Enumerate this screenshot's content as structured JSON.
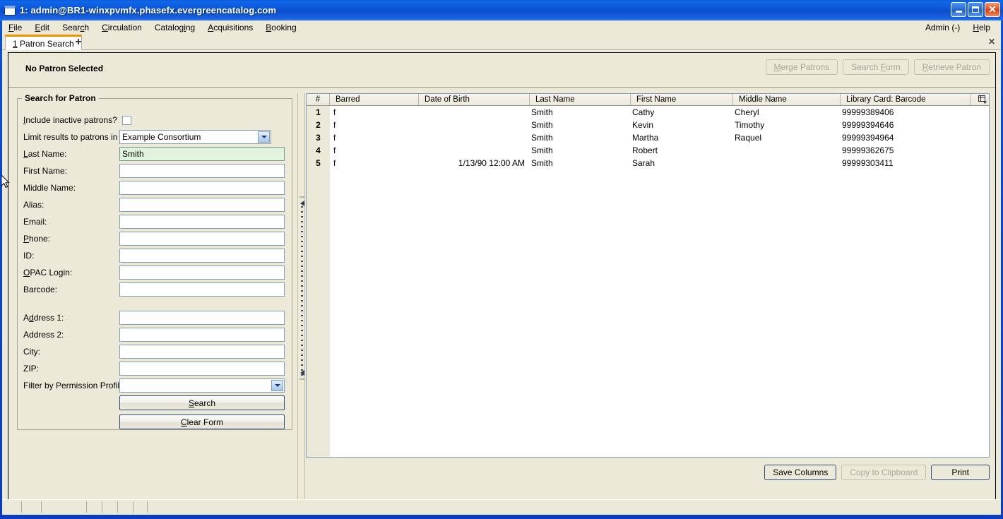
{
  "window": {
    "title": "1: admin@BR1-winxpvmfx.phasefx.evergreencatalog.com",
    "icon": "window-icon",
    "minimize_label": "_",
    "maximize_label": "□",
    "close_label": "✕"
  },
  "menubar": {
    "items": [
      {
        "label": "File"
      },
      {
        "label": "Edit"
      },
      {
        "label": "Search"
      },
      {
        "label": "Circulation"
      },
      {
        "label": "Cataloging"
      },
      {
        "label": "Acquisitions"
      },
      {
        "label": "Booking"
      }
    ],
    "right_items": [
      {
        "label": "Admin (-)"
      },
      {
        "label": "Help"
      }
    ]
  },
  "tabs": {
    "active": {
      "label": "1 Patron Search"
    },
    "new_tab_label": "+",
    "close_label": "✕"
  },
  "patron_header": {
    "status": "No Patron Selected",
    "buttons": [
      {
        "label": "Merge Patrons",
        "enabled": false
      },
      {
        "label": "Search Form",
        "enabled": false
      },
      {
        "label": "Retrieve Patron",
        "enabled": false
      }
    ]
  },
  "search_form": {
    "legend": "Search for Patron",
    "fields": [
      {
        "label": "Include inactive patrons?",
        "type": "checkbox",
        "value": "",
        "checked": false
      },
      {
        "label": "Limit results to patrons in",
        "type": "select",
        "value": "Example Consortium"
      },
      {
        "label": "Last Name:",
        "type": "text",
        "value": "Smith",
        "focused": true
      },
      {
        "label": "First Name:",
        "type": "text",
        "value": ""
      },
      {
        "label": "Middle Name:",
        "type": "text",
        "value": ""
      },
      {
        "label": "Alias:",
        "type": "text",
        "value": ""
      },
      {
        "label": "Email:",
        "type": "text",
        "value": ""
      },
      {
        "label": "Phone:",
        "type": "text",
        "value": ""
      },
      {
        "label": "ID:",
        "type": "text",
        "value": ""
      },
      {
        "label": "OPAC Login:",
        "type": "text",
        "value": ""
      },
      {
        "label": "Barcode:",
        "type": "text",
        "value": ""
      },
      {
        "label": "Address 1:",
        "type": "text",
        "value": ""
      },
      {
        "label": "Address 2:",
        "type": "text",
        "value": ""
      },
      {
        "label": "City:",
        "type": "text",
        "value": ""
      },
      {
        "label": "ZIP:",
        "type": "text",
        "value": ""
      },
      {
        "label": "Filter by Permission Profile:",
        "type": "select",
        "value": ""
      }
    ],
    "search_button": "Search",
    "clear_button": "Clear Form"
  },
  "results": {
    "columns": [
      {
        "label": "#"
      },
      {
        "label": "Barred"
      },
      {
        "label": "Date of Birth"
      },
      {
        "label": "Last Name"
      },
      {
        "label": "First Name"
      },
      {
        "label": "Middle Name"
      },
      {
        "label": "Library Card: Barcode"
      }
    ],
    "rows": [
      {
        "num": "1",
        "barred": "f",
        "dob": "",
        "last": "Smith",
        "first": "Cathy",
        "middle": "Cheryl",
        "barcode": "99999389406"
      },
      {
        "num": "2",
        "barred": "f",
        "dob": "",
        "last": "Smith",
        "first": "Kevin",
        "middle": "Timothy",
        "barcode": "99999394646"
      },
      {
        "num": "3",
        "barred": "f",
        "dob": "",
        "last": "Smith",
        "first": "Martha",
        "middle": "Raquel",
        "barcode": "99999394964"
      },
      {
        "num": "4",
        "barred": "f",
        "dob": "",
        "last": "Smith",
        "first": "Robert",
        "middle": "",
        "barcode": "99999362675"
      },
      {
        "num": "5",
        "barred": "f",
        "dob": "1/13/90 12:00 AM",
        "last": "Smith",
        "first": "Sarah",
        "middle": "",
        "barcode": "99999303411"
      }
    ],
    "footer_buttons": [
      {
        "label": "Save Columns",
        "enabled": true,
        "default": true
      },
      {
        "label": "Copy to Clipboard",
        "enabled": false,
        "default": false
      },
      {
        "label": "Print",
        "enabled": true,
        "default": true
      }
    ]
  },
  "colors": {
    "window_chrome": "#0a46c9",
    "panel_bg": "#ece9d8",
    "field_border": "#7f9db9",
    "focused_field_bg": "#e3f4de",
    "active_tab_accent": "#f29400",
    "default_button_border": "#2c4c7c"
  }
}
